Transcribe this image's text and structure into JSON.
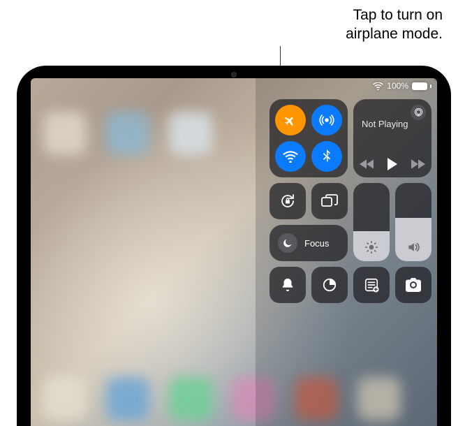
{
  "callout": {
    "line1": "Tap to turn on",
    "line2": "airplane mode."
  },
  "status": {
    "battery_pct": "100%"
  },
  "connectivity": {
    "airplane": {
      "active_color": "#ff9500"
    },
    "airdrop": {
      "active_color": "#0a7bff"
    },
    "wifi": {
      "active_color": "#0a7bff"
    },
    "bluetooth": {
      "active_color": "#0a7bff"
    }
  },
  "media": {
    "title": "Not Playing"
  },
  "focus": {
    "label": "Focus"
  },
  "sliders": {
    "brightness_pct": 38,
    "volume_pct": 55
  }
}
